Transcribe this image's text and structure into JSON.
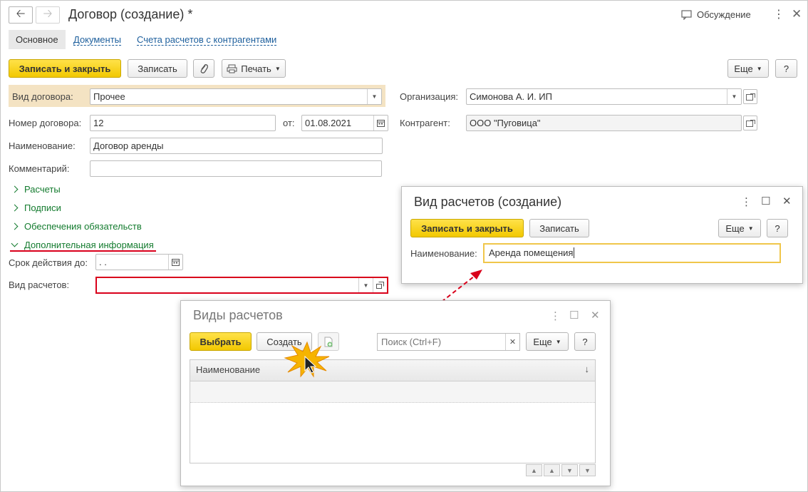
{
  "window": {
    "title": "Договор (создание) *",
    "discussion_label": "Обсуждение"
  },
  "tabs": [
    {
      "label": "Основное"
    },
    {
      "label": "Документы"
    },
    {
      "label": "Счета расчетов с контрагентами"
    }
  ],
  "toolbar": {
    "save_close": "Записать и закрыть",
    "save": "Записать",
    "print": "Печать",
    "more": "Еще",
    "help": "?"
  },
  "form": {
    "contract_type_label": "Вид договора:",
    "contract_type_value": "Прочее",
    "number_label": "Номер договора:",
    "number_value": "12",
    "from_label": "от:",
    "date_value": "01.08.2021",
    "name_label": "Наименование:",
    "name_value": "Договор аренды",
    "comment_label": "Комментарий:",
    "comment_value": "",
    "org_label": "Организация:",
    "org_value": "Симонова А. И. ИП",
    "counterparty_label": "Контрагент:",
    "counterparty_value": "ООО \"Пуговица\"",
    "groups": [
      {
        "label": "Расчеты",
        "expanded": false
      },
      {
        "label": "Подписи",
        "expanded": false
      },
      {
        "label": "Обеспечения обязательств",
        "expanded": false
      },
      {
        "label": "Дополнительная информация",
        "expanded": true
      }
    ],
    "validity_label": "Срок действия до:",
    "validity_value": " .  .",
    "settlement_label": "Вид расчетов:",
    "settlement_value": ""
  },
  "dialog_create": {
    "title": "Вид расчетов (создание)",
    "save_close": "Записать и закрыть",
    "save": "Записать",
    "more": "Еще",
    "help": "?",
    "name_label": "Наименование:",
    "name_value": "Аренда помещения"
  },
  "dialog_list": {
    "title": "Виды расчетов",
    "select": "Выбрать",
    "create": "Создать",
    "search_placeholder": "Поиск (Ctrl+F)",
    "more": "Еще",
    "help": "?",
    "column_name": "Наименование"
  },
  "colors": {
    "primary_button": "#f2c800",
    "group_link": "#137b2e",
    "tab_link": "#1c5e9c",
    "highlight_red": "#d9001b"
  }
}
